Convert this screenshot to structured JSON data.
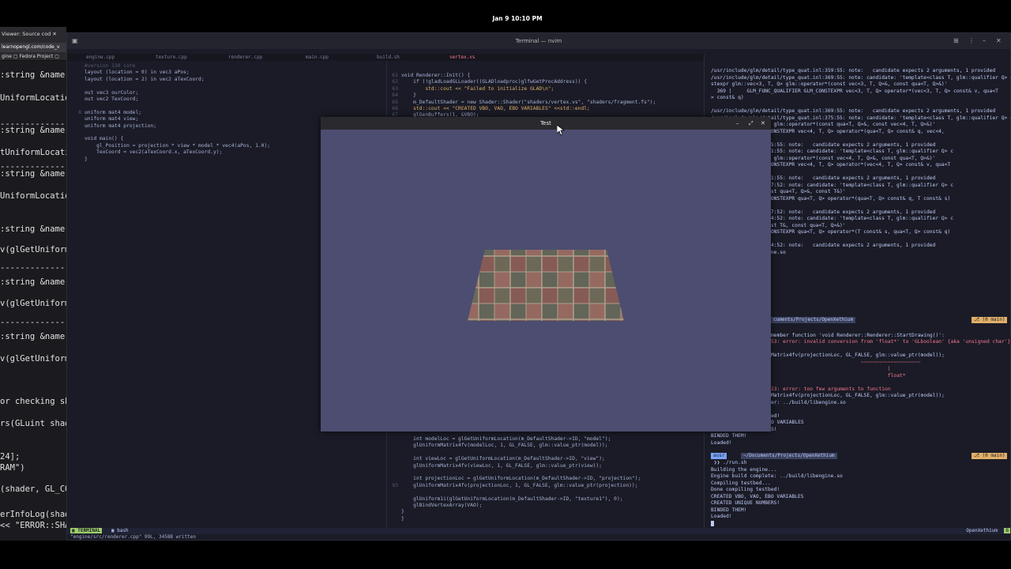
{
  "topbar": {
    "clock": "Jan 9  10:10 PM"
  },
  "browser": {
    "tab_title": "Viewer: Source cod",
    "url": "learnopengl.com/code_v",
    "bookmarks": "gine  ▢ Fedora Project  ▢",
    "code_lines": [
      ":string &name",
      "UniformLocation",
      "---------------",
      ":string &name",
      "tUniformLocati",
      "---------------",
      ":string &name",
      "UniformLocatio",
      ":string &name",
      "v(glGetUniform",
      "---------------",
      ":string &name",
      "v(glGetUniform",
      "---------------",
      ":string &name",
      "v(glGetUniform",
      "or checking sh",
      "rs(GLuint shad",
      "24];",
      "RAM\")",
      "(shader, GL_CO",
      "erInfoLog(shad",
      "<< \"ERROR::SHA"
    ]
  },
  "terminal": {
    "title": "Terminal — nvim",
    "tabs": [
      "engine.cpp",
      "texture.cpp",
      "renderer.cpp",
      "main.cpp",
      "build.sh",
      "vertex.vs"
    ],
    "left_code": [
      "#version 330 core",
      "layout (location = 0) in vec3 aPos;",
      "layout (location = 2) in vec2 aTexCoord;",
      "",
      "out vec3 ourColor;",
      "out vec2 TexCoord;",
      "",
      "uniform mat4 model;",
      "uniform mat4 view;",
      "uniform mat4 projection;",
      "",
      "void main() {",
      "    gl_Position = projection * view * model * vec4(aPos, 1.0);",
      "    TexCoord = vec2(aTexCoord.x, aTexCoord.y);",
      "}"
    ],
    "left_line_nums": [
      "",
      "",
      "",
      "",
      "",
      "",
      "",
      "8",
      "",
      "",
      "",
      "",
      "",
      "",
      ""
    ],
    "mid_code_top": [
      "void Renderer::Init() {",
      "    if (!gladLoadGLLoader((GLADloadproc)glfwGetProcAddress)) {",
      "        std::cout << \"Failed to initialize GLAD\\n\";",
      "    }",
      "    m_DefaultShader = new Shader::Shader(\"shaders/vertex.vs\", \"shaders/fragment.fs\");",
      "    std::cout << \"CREATED VBO, VAO, EBO VARIABLES\" <<std::endl;",
      "    glGenBuffers(1, &VBO);"
    ],
    "mid_nums_top": [
      "61",
      "62",
      "63",
      "64",
      "65",
      "66",
      "67"
    ],
    "mid_code_bottom": [
      "    int modelLoc = glGetUniformLocation(m_DefaultShader->ID, \"model\");",
      "    glUniformMatrix4fv(modelLoc, 1, GL_FALSE, glm::value_ptr(model));",
      "",
      "    int viewLoc = glGetUniformLocation(m_DefaultShader->ID, \"view\");",
      "    glUniformMatrix4fv(viewLoc, 1, GL_FALSE, glm::value_ptr(view));",
      "",
      "    int projectionLoc = glGetUniformLocation(m_DefaultShader->ID, \"projection\");",
      "    glUniformMatrix4fv(projectionLoc, 1, GL_FALSE, glm::value_ptr(projection));",
      "",
      "    glUniform1i(glGetUniformLocation(m_DefaultShader->ID, \"texture1\"), 0);",
      "    glBindVertexArray(VAO);",
      "}",
      "}"
    ],
    "mid_nums_bottom": [
      "",
      "",
      "",
      "",
      "",
      "",
      "",
      "93",
      "",
      "",
      "",
      "",
      ""
    ],
    "right_lines": [
      "/usr/include/glm/detail/type_quat.inl:359:55: note:   candidate expects 2 arguments, 1 provided",
      "/usr/include/glm/detail/type_quat.inl:369:55: note: candidate: 'template<class T, glm::qualifier Q> c",
      "stexpr glm::vec<3, T, Q> glm::operator*(const vec<3, T, Q>&, const qua<T, Q>&)'",
      "  369 |     GLM_FUNC_QUALIFIER GLM_CONSTEXPR vec<3, T, Q> operator*(vec<3, T, Q> const& v, qua<T",
      "> const& q)",
      "",
      "/usr/include/glm/detail/type_quat.inl:369:55: note:   candidate expects 2 arguments, 1 provided",
      "/usr/include/glm/detail/type_quat.inl:375:55: note: candidate: 'template<class T, glm::qualifier Q> c",
      "tr glm::vec<4, T, Q> glm::operator*(const qua<T, Q>&, const vec<4, T, Q>&)'",
      "FUNC_QUALIFIER GLM_CONSTEXPR vec<4, T, Q> operator*(qua<T, Q> const& q, vec<4,",
      "",
      "ail/type_quat.inl:375:55: note:   candidate expects 2 arguments, 1 provided",
      "ail/type_quat.inl:381:55: note: candidate: 'template<class T, glm::qualifier Q> c",
      "tr glm::vec<4, T, Q> glm::operator*(const vec<4, T, Q>&, const qua<T, Q>&)'",
      "FUNC_QUALIFIER GLM_CONSTEXPR vec<4, T, Q> operator*(vec<4, T, Q> const& v, qua<T",
      "",
      "ail/type_quat.inl:381:55: note:   candidate expects 2 arguments, 1 provided",
      "ail/type_quat.inl:387:52: note: candidate: 'template<class T, glm::qualifier Q> c",
      "r glm::operator*(const qua<T, Q>&, const T&)'",
      "FUNC_QUALIFIER GLM_CONSTEXPR qua<T, Q> operator*(qua<T, Q> const& q, T const& s)",
      "",
      "ail/type_quat.inl:387:52: note:   candidate expects 2 arguments, 1 provided",
      "ail/type_quat.inl:394:52: note: candidate: 'template<class T, glm::qualifier Q> c",
      "r glm::operator*(const T&, const qua<T, Q>&)'",
      "FUNC_QUALIFIER GLM_CONSTEXPR qua<T, Q> operator*(T const& s, qua<T, Q> const& q)",
      "",
      "ail/type_quat.inl:394:52: note:   candidate expects 2 arguments, 1 provided",
      "er: ../build/libengine.so",
      "",
      "ed!",
      "O VARIABLES",
      "S!"
    ],
    "prompt1": "cuments/Projects/OpenXethium",
    "branch1": "⎇ (0 main)",
    "right_lines_2": [
      "",
      "member function 'void Renderer::Renderer::StartDrawing()':",
      "53: error: invalid conversion from 'float*' to 'GLboolean' {aka 'unsigned char'}",
      "",
      "Matrix4fv(projectionLoc, GL_FALSE, glm::value_ptr(model));",
      "                              ~~~~~~~~~~~~~~~~~~~~",
      "                                       |",
      "                                       float*",
      "",
      "23: error: too few arguments to function",
      "Matrix4fv(projectionLoc, GL_FALSE, glm::value_ptr(model));",
      "er: ../build/libengine.so",
      "",
      "ed!",
      "O VARIABLES",
      "S!"
    ],
    "right_lines_3": [
      "BINDED THEM!",
      "Loaded!"
    ],
    "prompt2_user": " ausr ",
    "prompt2": "~/Documents/Projects/OpenXethium",
    "branch2": "⎇ (0 main)",
    "right_lines_4": [
      " ❯❯ ./run.sh",
      "Building the engine...",
      "Engine build complete: ../build/libengine.so",
      "Compiling testbed...",
      "Done compiling testbed!",
      "CREATED VBO, VAO, EBO VARIABLES",
      "CREATED UNIQUE NUMBERS!",
      "BINDED THEM!",
      "Loaded!"
    ],
    "status_mode": "▣ TERMINAL",
    "status_bash": "▣ bash",
    "status_right": "OpenXethium",
    "status_right2": "B",
    "msg": "\"engine/src/renderer.cpp\" 99L, 3458B written"
  },
  "test_window": {
    "title": "Test"
  }
}
